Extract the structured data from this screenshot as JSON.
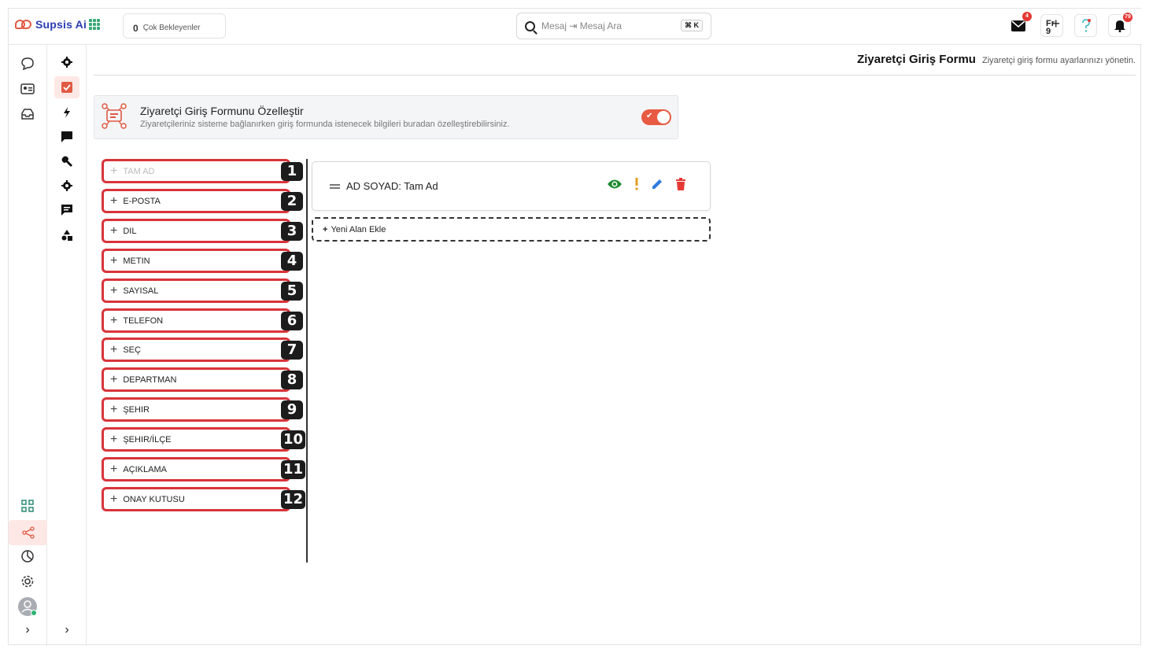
{
  "app": {
    "name": "Supsis Ai"
  },
  "topbar": {
    "pending_count": "0",
    "pending_label": "Çok Bekleyenler",
    "search_placeholder": "Mesaj ⇥ Mesaj Ara",
    "search_shortcut": "⌘ K",
    "mail_badge": "4",
    "lang_code": "Fr",
    "lang_count": "9",
    "notif_badge": "79"
  },
  "sidebar": {
    "rail1": [
      "chat-icon",
      "contact-card-icon",
      "inbox-icon",
      "dashboard-grid-icon",
      "share-icon",
      "clock-chart-icon",
      "settings-icon",
      "avatar"
    ],
    "rail2": [
      "gear-icon",
      "checkbox-icon",
      "bolt-icon",
      "message-icon",
      "wrench-icon",
      "gear-icon",
      "comment-icon",
      "shapes-icon"
    ],
    "active_rail2_index": 1
  },
  "page": {
    "title": "Ziyaretçi Giriş Formu",
    "subtitle": "Ziyaretçi giriş formu ayarlarınızı yönetin."
  },
  "customize_card": {
    "title": "Ziyaretçi Giriş Formunu Özelleştir",
    "description": "Ziyaretçileriniz sisteme bağlanırken giriş formunda istenecek bilgileri buradan özelleştirebilirsiniz.",
    "enabled": true
  },
  "fields": [
    {
      "label": "TAM AD",
      "number": "1",
      "disabled": true
    },
    {
      "label": "E-POSTA",
      "number": "2",
      "disabled": false
    },
    {
      "label": "DIL",
      "number": "3",
      "disabled": false
    },
    {
      "label": "METIN",
      "number": "4",
      "disabled": false
    },
    {
      "label": "SAYISAL",
      "number": "5",
      "disabled": false
    },
    {
      "label": "TELEFON",
      "number": "6",
      "disabled": false
    },
    {
      "label": "SEÇ",
      "number": "7",
      "disabled": false
    },
    {
      "label": "DEPARTMAN",
      "number": "8",
      "disabled": false
    },
    {
      "label": "ŞEHIR",
      "number": "9",
      "disabled": false
    },
    {
      "label": "ŞEHIR/İLÇE",
      "number": "10",
      "disabled": false
    },
    {
      "label": "AÇIKLAMA",
      "number": "11",
      "disabled": false
    },
    {
      "label": "ONAY KUTUSU",
      "number": "12",
      "disabled": false
    }
  ],
  "form_preview": {
    "row_label": "AD SOYAD: Tam Ad",
    "add_field_label": "Yeni Alan Ekle",
    "colors": {
      "visible": "#1e8a2e",
      "required": "#e0a020",
      "edit": "#2f7be0",
      "delete": "#e53935"
    }
  }
}
